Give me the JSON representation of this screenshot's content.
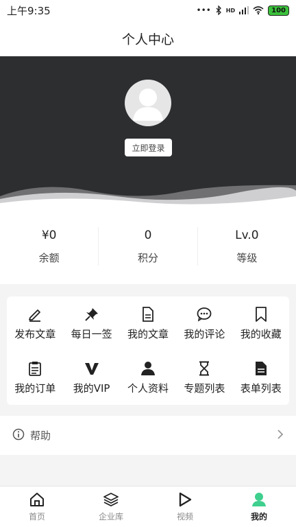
{
  "statusbar": {
    "time": "上午9:35",
    "network": "HD",
    "battery": "100"
  },
  "header": {
    "title": "个人中心"
  },
  "hero": {
    "login_label": "立即登录"
  },
  "stats": [
    {
      "value": "¥0",
      "label": "余额"
    },
    {
      "value": "0",
      "label": "积分"
    },
    {
      "value": "Lv.0",
      "label": "等级"
    }
  ],
  "menu": [
    {
      "label": "发布文章",
      "icon": "pencil-icon"
    },
    {
      "label": "每日一签",
      "icon": "pin-icon"
    },
    {
      "label": "我的文章",
      "icon": "document-icon"
    },
    {
      "label": "我的评论",
      "icon": "comment-icon"
    },
    {
      "label": "我的收藏",
      "icon": "bookmark-icon"
    },
    {
      "label": "我的订单",
      "icon": "clipboard-icon"
    },
    {
      "label": "我的VIP",
      "icon": "vip-icon"
    },
    {
      "label": "个人资料",
      "icon": "user-icon"
    },
    {
      "label": "专题列表",
      "icon": "hourglass-icon"
    },
    {
      "label": "表单列表",
      "icon": "form-icon"
    }
  ],
  "help": {
    "label": "帮助"
  },
  "tabs": [
    {
      "label": "首页",
      "icon": "home-icon",
      "active": false
    },
    {
      "label": "企业库",
      "icon": "layers-icon",
      "active": false
    },
    {
      "label": "视频",
      "icon": "play-icon",
      "active": false
    },
    {
      "label": "我的",
      "icon": "profile-icon",
      "active": true
    }
  ],
  "colors": {
    "hero_bg": "#2d2e30",
    "active_tab_icon": "#3fcf8e"
  }
}
